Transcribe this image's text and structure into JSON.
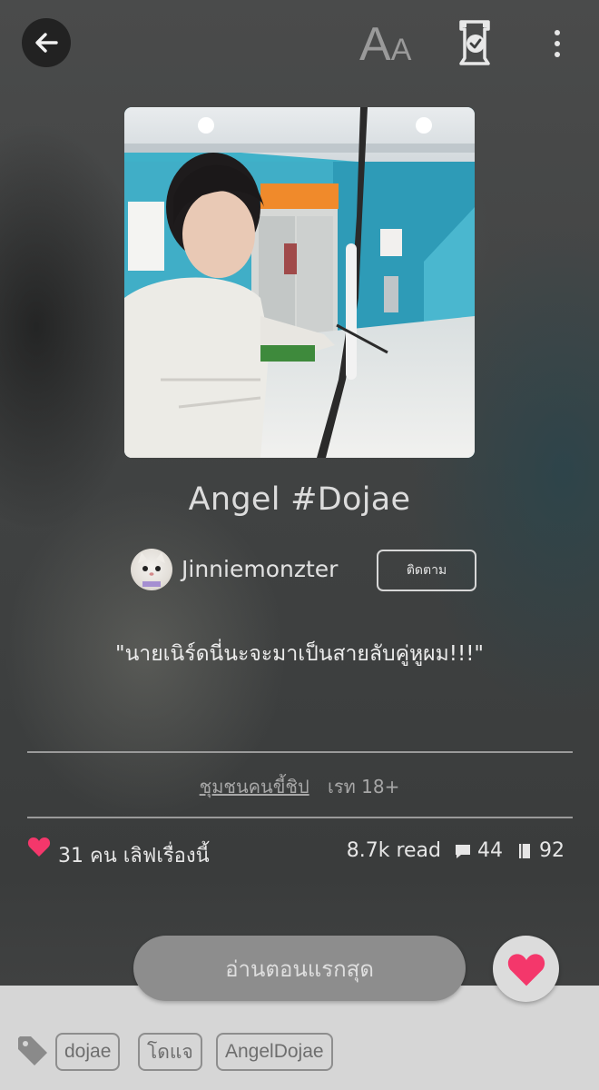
{
  "header": {
    "back_icon": "arrow-left-icon",
    "font_size_icon": "text-size-icon",
    "font_size_label_big": "A",
    "font_size_label_small": "A",
    "library_icon": "bookmark-check-icon",
    "menu_icon": "more-vertical-icon"
  },
  "story": {
    "cover_image": "cover-photo",
    "title": "Angel #Dojae",
    "author": {
      "name": "Jinniemonzter",
      "avatar_icon": "cat-avatar",
      "follow_label": "ติดตาม"
    },
    "tagline": "\"นายเนิร์ดนี่นะจะมาเป็นสายลับคู่หูผม!!!\"",
    "category": "ชุมชนคนขี้ชิป",
    "rating": "เรท 18+",
    "loves": "31 คน เลิฟเรื่องนี้",
    "reads": "8.7k read",
    "comments": "44",
    "chapters": "92"
  },
  "actions": {
    "read_first_label": "อ่านตอนแรกสุด",
    "favorite_icon": "heart-icon"
  },
  "tags": [
    "dojae",
    "โดแจ",
    "AngelDojae"
  ],
  "colors": {
    "accent_pink": "#f4376b",
    "background": "#3d3f3f",
    "bottom_panel": "#d6d6d6"
  }
}
